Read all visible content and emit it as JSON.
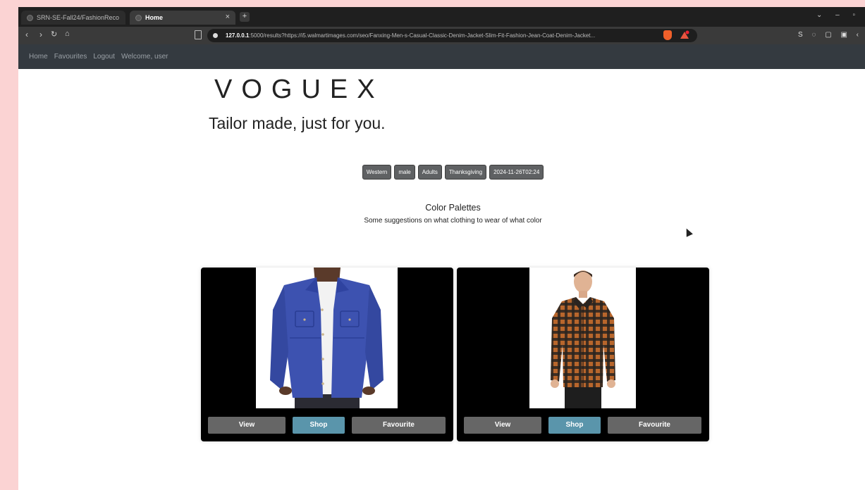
{
  "browser": {
    "tabs": [
      {
        "label": "SRN-SE-Fall24/FashionReco"
      },
      {
        "label": "Home"
      }
    ],
    "url_host": "127.0.0.1",
    "url_rest": ":5000/results?https://i5.walmartimages.com/seo/Fanxing-Men-s-Casual-Classic-Denim-Jacket-Slim-Fit-Fashion-Jean-Coat-Denim-Jacket...",
    "nav_icons": [
      "back-icon",
      "forward-icon",
      "reload-icon",
      "home-icon"
    ],
    "new_tab": "+",
    "tab_close": "×"
  },
  "site_nav": {
    "items": [
      "Home",
      "Favourites",
      "Logout"
    ],
    "welcome": "Welcome, user"
  },
  "hero": {
    "brand": "VOGUEX",
    "tagline": "Tailor made, just for you."
  },
  "badges": [
    "Western",
    "male",
    "Adults",
    "Thanksgiving",
    "2024-11-26T02:24"
  ],
  "palettes": {
    "title": "Color Palettes",
    "subtitle": "Some suggestions on what clothing to wear of what color"
  },
  "cards": [
    {
      "item": "denim jacket",
      "view": "View",
      "shop": "Shop",
      "favourite": "Favourite"
    },
    {
      "item": "plaid shirt",
      "view": "View",
      "shop": "Shop",
      "favourite": "Favourite"
    }
  ],
  "colors": {
    "page_bg": "#fbd3d3",
    "navbar": "#343a40",
    "badge": "#5f6163",
    "shop_button": "#5a95ab",
    "neutral_button": "#666666",
    "denim": "#3d52b0",
    "plaid_orange": "#b8662c"
  }
}
